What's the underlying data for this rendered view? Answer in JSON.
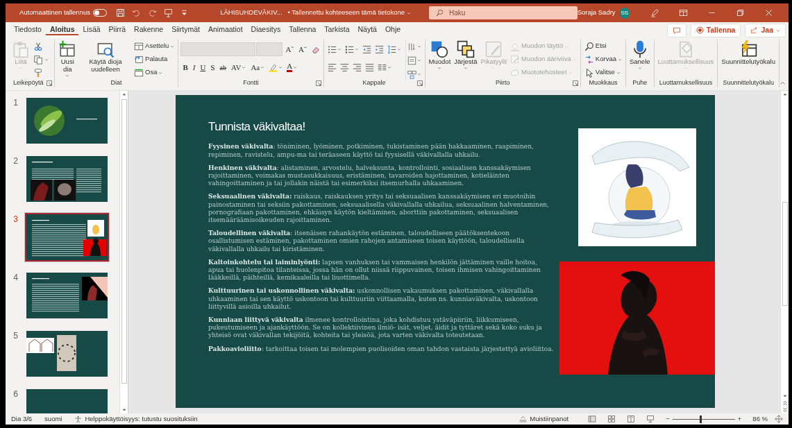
{
  "title_bar": {
    "autosave_label": "Automaattinen tallennus",
    "autosave_on": false,
    "file_name": "LÄHISUHDEVÄKIV...",
    "save_status": "• Tallennettu kohteeseen tämä tietokone",
    "search_placeholder": "Haku",
    "user_name": "Soraja Sadry",
    "user_initials": "SS"
  },
  "menu_tabs": [
    {
      "label": "Tiedosto",
      "selected": false
    },
    {
      "label": "Aloitus",
      "selected": true
    },
    {
      "label": "Lisää",
      "selected": false
    },
    {
      "label": "Piirrä",
      "selected": false
    },
    {
      "label": "Rakenne",
      "selected": false
    },
    {
      "label": "Siirtymät",
      "selected": false
    },
    {
      "label": "Animaatiot",
      "selected": false
    },
    {
      "label": "Diaesitys",
      "selected": false
    },
    {
      "label": "Tallenna",
      "selected": false
    },
    {
      "label": "Tarkista",
      "selected": false
    },
    {
      "label": "Näytä",
      "selected": false
    },
    {
      "label": "Ohje",
      "selected": false
    }
  ],
  "menu_actions": {
    "record": "Tallenna",
    "share": "Jaa"
  },
  "ribbon": [
    {
      "label": "Leikepöytä",
      "launcher": true,
      "commands": [
        {
          "kind": "large",
          "label": "Liitä",
          "disabled": true,
          "dropdown": true
        },
        {
          "kind": "small",
          "disabled": false,
          "dropdown": false
        },
        {
          "kind": "small",
          "disabled": false,
          "dropdown": true
        },
        {
          "kind": "small",
          "disabled": false,
          "dropdown": false
        }
      ]
    },
    {
      "label": "Diat",
      "launcher": false,
      "commands": [
        {
          "kind": "large",
          "label": "Uusi dia",
          "disabled": false,
          "dropdown": true
        },
        {
          "kind": "large",
          "label": "Käytä dioja uudelleen",
          "disabled": false,
          "dropdown": false
        },
        {
          "kind": "small",
          "label": "Asettelu",
          "disabled": false,
          "dropdown": true
        },
        {
          "kind": "small",
          "label": "Palauta",
          "disabled": false,
          "dropdown": false
        },
        {
          "kind": "small",
          "label": "Osa",
          "disabled": false,
          "dropdown": true
        }
      ]
    },
    {
      "label": "Fontti",
      "launcher": true,
      "top_row": [
        {
          "kind": "font_field",
          "disabled": true
        },
        {
          "kind": "size_field",
          "disabled": true
        },
        {
          "kind": "letter",
          "label": "Aˆ",
          "dropdown": false
        },
        {
          "kind": "letter",
          "label": "Aˇ",
          "dropdown": false
        },
        {
          "kind": "icon",
          "dropdown": false
        }
      ],
      "bottom_row": [
        {
          "kind": "letter",
          "label": "B",
          "dropdown": false
        },
        {
          "kind": "letter",
          "label": "I",
          "dropdown": false
        },
        {
          "kind": "letter",
          "label": "U",
          "dropdown": false
        },
        {
          "kind": "letter",
          "label": "S",
          "dropdown": false
        },
        {
          "kind": "letter",
          "label": "ab",
          "dropdown": false
        },
        {
          "kind": "letter",
          "label": "AV",
          "dropdown": true
        },
        {
          "kind": "letter",
          "label": "Aa",
          "dropdown": true
        },
        {
          "kind": "icon",
          "dropdown": true
        },
        {
          "kind": "letter",
          "label": "A",
          "dropdown": true
        }
      ]
    },
    {
      "label": "Kappale",
      "launcher": true,
      "top_row": [
        {
          "kind": "icon",
          "dropdown": true
        },
        {
          "kind": "icon",
          "dropdown": true
        },
        {
          "kind": "icon",
          "dropdown": false
        },
        {
          "kind": "icon",
          "dropdown": false
        },
        {
          "kind": "icon",
          "dropdown": true
        }
      ],
      "bottom_row": [
        {
          "kind": "icon",
          "dropdown": false
        },
        {
          "kind": "icon",
          "dropdown": false
        },
        {
          "kind": "icon",
          "dropdown": false
        },
        {
          "kind": "icon",
          "dropdown": false
        },
        {
          "kind": "icon",
          "dropdown": true
        }
      ],
      "side_column": [
        {
          "kind": "icon",
          "dropdown": true
        },
        {
          "kind": "icon",
          "dropdown": true
        },
        {
          "kind": "icon",
          "dropdown": true
        }
      ]
    },
    {
      "label": "Piirto",
      "launcher": true,
      "commands": [
        {
          "kind": "large",
          "label": "Muodot",
          "disabled": false,
          "dropdown": true
        },
        {
          "kind": "large",
          "label": "Järjestä",
          "disabled": false,
          "dropdown": true
        },
        {
          "kind": "large",
          "label": "Pikatyylit",
          "disabled": true,
          "dropdown": true
        },
        {
          "kind": "small",
          "label": "Muodon täyttö",
          "disabled": true,
          "dropdown": true
        },
        {
          "kind": "small",
          "label": "Muodon ääriviiva",
          "disabled": true,
          "dropdown": true
        },
        {
          "kind": "small",
          "label": "Muototehosteet",
          "disabled": true,
          "dropdown": true
        }
      ]
    },
    {
      "label": "Muokkaus",
      "launcher": false,
      "commands": [
        {
          "kind": "small",
          "label": "Etsi",
          "disabled": false,
          "dropdown": false
        },
        {
          "kind": "small",
          "label": "Korvaa",
          "disabled": false,
          "dropdown": true
        },
        {
          "kind": "small",
          "label": "Valitse",
          "disabled": false,
          "dropdown": true
        }
      ]
    },
    {
      "label": "Puhe",
      "launcher": false,
      "commands": [
        {
          "kind": "large",
          "label": "Sanele",
          "disabled": false,
          "dropdown": true
        }
      ]
    },
    {
      "label": "Luottamuksellisuus",
      "launcher": false,
      "commands": [
        {
          "kind": "large",
          "label": "Luottamuksellisuus",
          "disabled": true,
          "dropdown": true
        }
      ]
    },
    {
      "label": "Suunnittelutyökalu",
      "launcher": false,
      "commands": [
        {
          "kind": "large",
          "label": "Suunnittelutyökalu",
          "disabled": false,
          "dropdown": false
        }
      ]
    }
  ],
  "thumbnails": [
    {
      "number": "1",
      "selected": false
    },
    {
      "number": "2",
      "selected": false
    },
    {
      "number": "3",
      "selected": true
    },
    {
      "number": "4",
      "selected": false
    },
    {
      "number": "5",
      "selected": false
    },
    {
      "number": "6",
      "selected": false
    }
  ],
  "slide": {
    "title": "Tunnista väkivaltaa!",
    "paragraphs": [
      "**Fyysinen väkivalta**: töniminen, lyöminen, potkiminen, tukistaminen pään hakkaaminen, raapiminen, repiminen, ravistelu, ampu-ma tai teräaseen käyttö tai fyysisellä väkivallalla uhkailu.",
      "**Henkinen väkivalta**:  alistaminen, arvostelu, halveksunta, kontrollointi, sosiaalisen kanssakäymisen rajoittaminen, voimakas mustasukkaisuus, eristäminen, tavaroiden hajottaminen, kotieläinten vahingoittaminen ja tai jollakin näistä tai esimerkiksi itsemurhalla uhkaaminen.",
      "**Seksuaalinen väkivalta:** raiskaus, raiskauksen yritys tai seksuaalisen kanssakäymisen eri muotoihin painostaminen tai seksiin pakottaminen, seksuaalisella väkivallalla uhkailua, seksuaalinen halventaminen, pornografiaan pakottaminen, ehkäisyn käytön kieltäminen, aborttiin pakottaminen, seksuaalisen itsemääräämisoikeuden rajoittaminen.",
      "**Taloudellinen väkivalta**:  itsenäisen rahankäytön estäminen,  taloudelliseen päätöksentekoon osallistumisen estäminen, pakottaminen omien rahojen antamiseen toisen käyttöön, taloudellisella väkivallalla uhkailu tai kiristäminen.",
      "**Kaltoinkohtelu tai laiminlyönti:** lapsen vanhuksen tai vammaisen henkilön jättäminen vaille hoitoa, apua tai huolenpitoa tilanteissa, jossa hän on ollut niissä riippuvainen, toisen ihmisen vahingoittaminen lääkkeillä, päihteillä, kemikaaleilla tai liuottimella.",
      "**Kulttuurinen tai uskonnollinen väkivalta:** uskonnollisen vakaumuksen pakottaminen, väkivallalla uhkaaminen tai sen käyttö uskontoon tai kulttuuriin viittaamalla, kuten ns. kunniaväkivalta, uskontoon liittyvillä asioilla uhkailut.",
      "**Kunniaan liittyvä väkivalta** ilmenee kontrollointina, joka kohdistuu ystäväpiiriin, liikkumiseen, pukeutumiseen ja ajankäyttöön. Se on kollektiivinen ilmiö- isät, veljet, äidit ja tyttäret sekä koko suku ja yhteisö ovat väkivallan tekijöitä, kohteita tai yleisöä, jota varten väkivalta toteutetaan.",
      "**Pakkoavioliitto**: tarkoittaa toisen tai molempien puolisoiden oman tahdon vastaista järjestettyä avioliittoa."
    ]
  },
  "status_bar": {
    "slide_counter": "Dia 3/6",
    "language": "suomi",
    "accessibility": "Helppokäyttöisyys: tutustu suosituksiin",
    "notes": "Muistiinpanot",
    "zoom_out": "−",
    "zoom_slider": {
      "level": 0.45
    },
    "zoom_in": "+",
    "zoom": "86 %"
  }
}
